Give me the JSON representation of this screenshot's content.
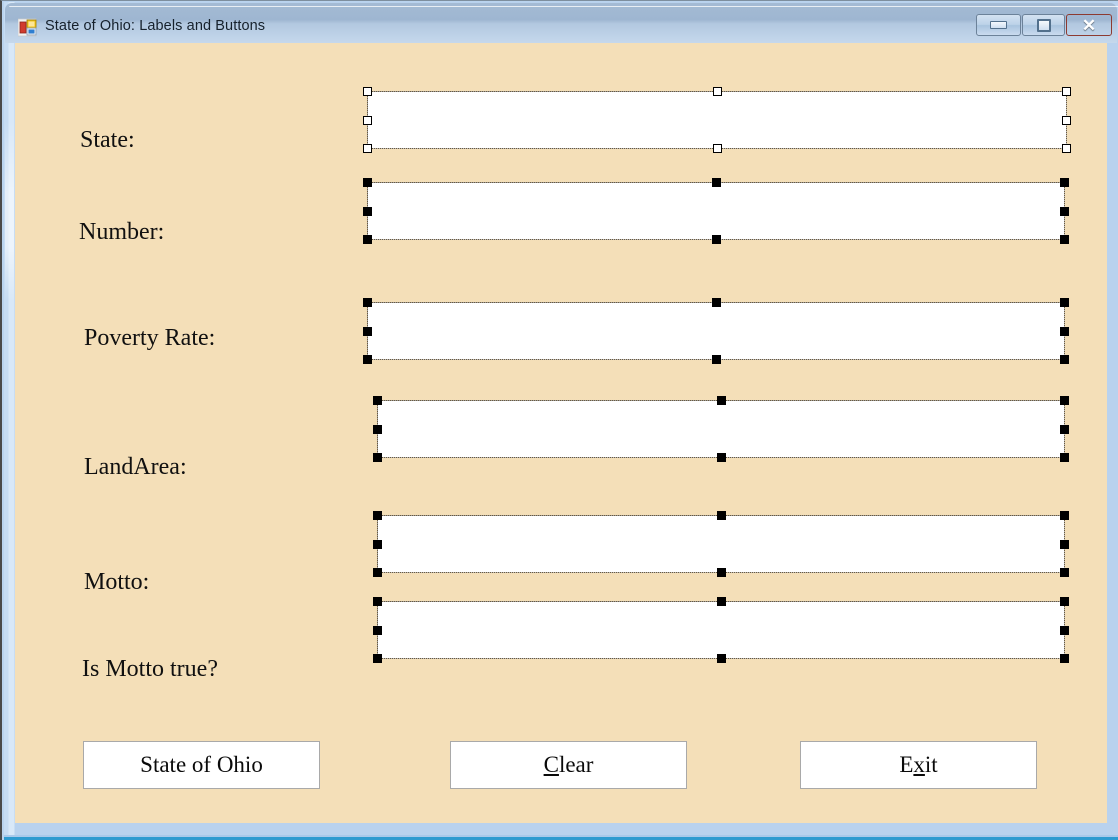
{
  "window": {
    "title": "State of Ohio: Labels and Buttons",
    "icon": "vb-form-icon",
    "controls": {
      "minimize": "minimize-icon",
      "maximize": "maximize-icon",
      "close": "close-icon"
    },
    "form_background": "#F4DFB8",
    "titlebar_color": "#9EB6D1",
    "frame_color": "#BAD4EF"
  },
  "form": {
    "fields": [
      {
        "label": "State:",
        "value": "",
        "selected": true,
        "handle_style": "hollow"
      },
      {
        "label": "Number:",
        "value": "",
        "selected": true,
        "handle_style": "filled"
      },
      {
        "label": "Poverty Rate:",
        "value": "",
        "selected": true,
        "handle_style": "filled"
      },
      {
        "label": "LandArea:",
        "value": "",
        "selected": true,
        "handle_style": "filled"
      },
      {
        "label": "Motto:",
        "value": "",
        "selected": true,
        "handle_style": "filled"
      },
      {
        "label": "Is Motto true?",
        "value": "",
        "selected": true,
        "handle_style": "filled"
      }
    ],
    "buttons": [
      {
        "text": "State of Ohio",
        "accel_before": "State of Ohio",
        "accel": "",
        "accel_after": ""
      },
      {
        "text": "Clear",
        "accel_before": "",
        "accel": "C",
        "accel_after": "lear"
      },
      {
        "text": "Exit",
        "accel_before": "E",
        "accel": "x",
        "accel_after": "it"
      }
    ]
  }
}
